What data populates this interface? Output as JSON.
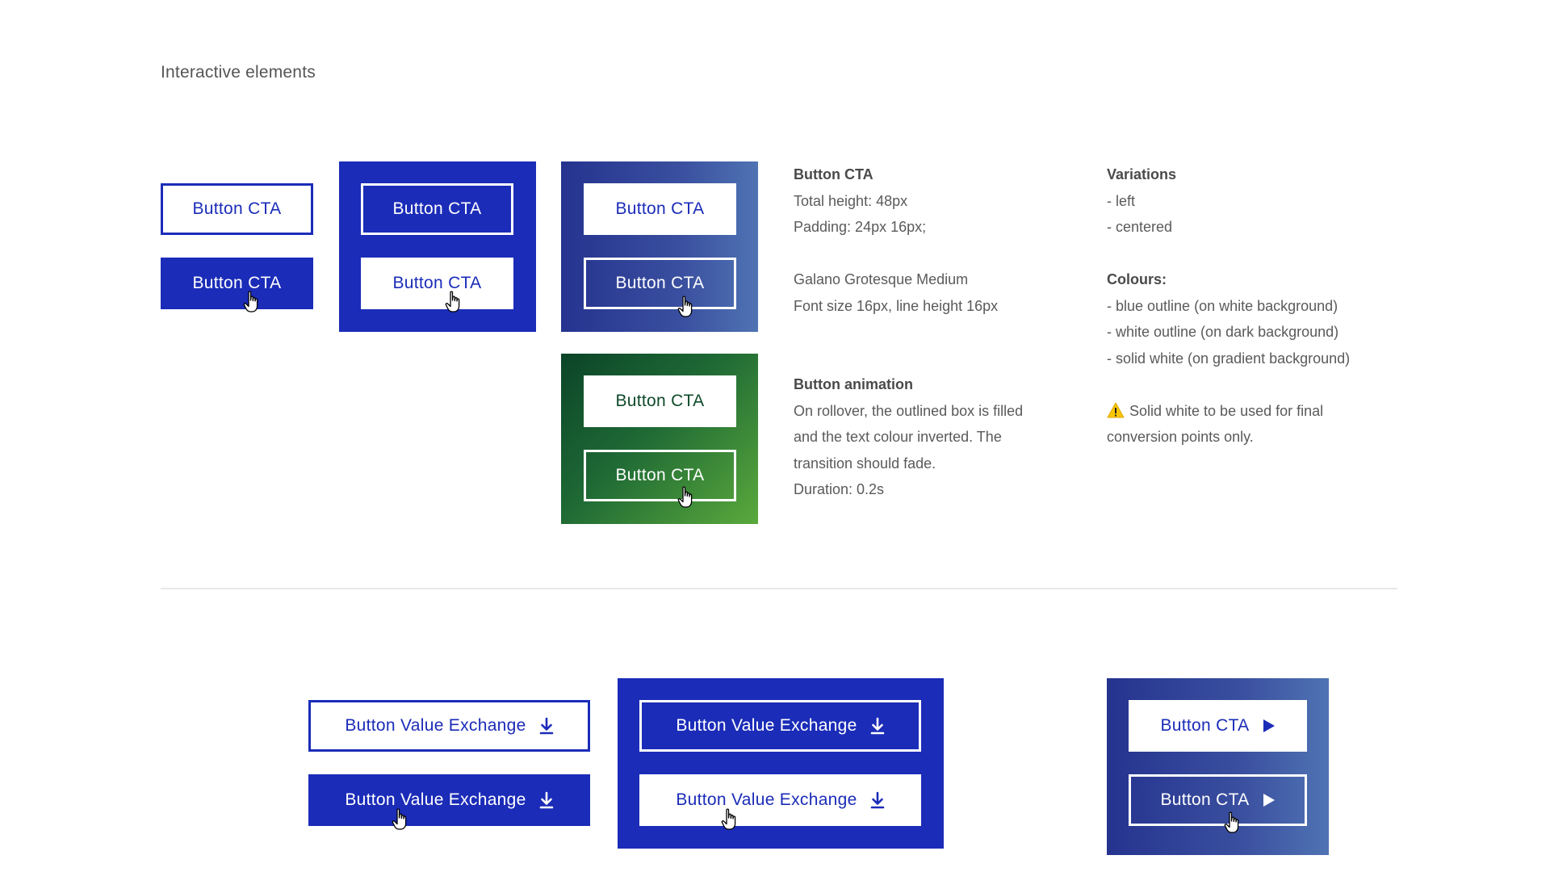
{
  "section_title": "Interactive elements",
  "button_cta_label": "Button CTA",
  "button_value_exchange_label": "Button Value Exchange",
  "colors": {
    "brand_blue": "#1b2cb8",
    "gradient_blue": [
      "#25338f",
      "#4f73b3"
    ],
    "gradient_green": [
      "#0b4428",
      "#5aa93c"
    ],
    "white": "#ffffff"
  },
  "icons": {
    "cursor": "hand-pointer-icon",
    "download": "download-icon",
    "play": "play-icon",
    "warning": "warning-icon"
  },
  "specs": {
    "title": "Button CTA",
    "total_height": "Total height: 48px",
    "padding": "Padding: 24px 16px;",
    "font_name": "Galano Grotesque Medium",
    "font_size": "Font size 16px, line height 16px",
    "animation_title": "Button animation",
    "animation_lines": [
      "On rollover, the outlined box is filled",
      "and the text colour inverted. The",
      "transition should fade.",
      "Duration: 0.2s"
    ]
  },
  "variations": {
    "title": "Variations",
    "items": [
      "- left",
      "- centered"
    ],
    "colours_title": "Colours:",
    "colours": [
      "- blue outline (on white background)",
      "- white outline (on dark background)",
      "- solid white (on gradient background)"
    ],
    "warning_lines": [
      "Solid white to be used for final",
      "conversion points only."
    ]
  }
}
